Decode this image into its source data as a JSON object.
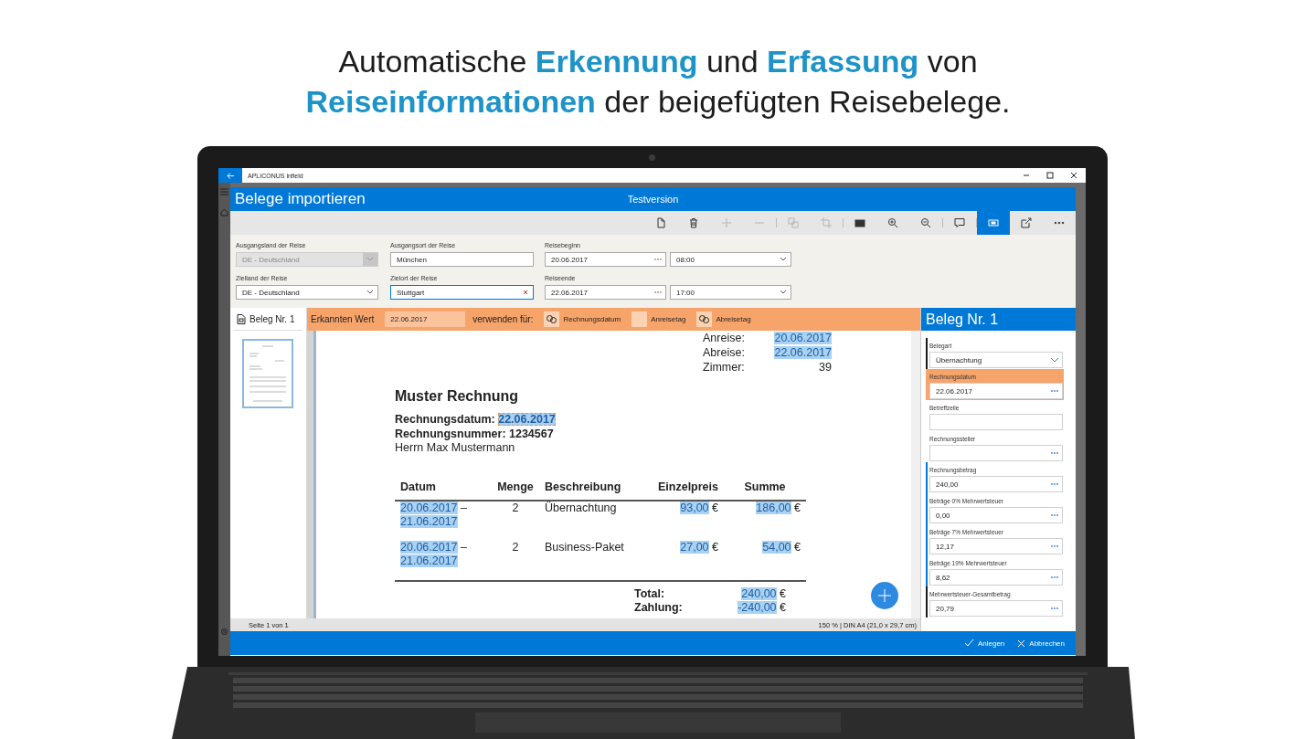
{
  "headline": {
    "lines": [
      "Automatische **Erkennung** und **Erfassung** von",
      "**Reiseinformationen** der beigefügten Reisebelege."
    ]
  },
  "window": {
    "title": "APLICONUS infield"
  },
  "dialog": {
    "title": "Belege importieren",
    "subtitle": "Testversion"
  },
  "toolbar": [
    {
      "kind": "new-document",
      "disabled": false,
      "selected": false
    },
    {
      "kind": "delete",
      "disabled": false,
      "selected": false
    },
    {
      "kind": "add",
      "disabled": true,
      "selected": false
    },
    {
      "kind": "remove",
      "disabled": true,
      "selected": false
    },
    {
      "kind": "separator"
    },
    {
      "kind": "copy",
      "disabled": true,
      "selected": false
    },
    {
      "kind": "crop",
      "disabled": true,
      "selected": false
    },
    {
      "kind": "separator"
    },
    {
      "kind": "fit",
      "disabled": false,
      "selected": false
    },
    {
      "kind": "zoom-in",
      "disabled": false,
      "selected": false
    },
    {
      "kind": "zoom-out",
      "disabled": false,
      "selected": false
    },
    {
      "kind": "separator"
    },
    {
      "kind": "comment",
      "disabled": false,
      "selected": false
    },
    {
      "kind": "separator"
    },
    {
      "kind": "scan",
      "disabled": false,
      "selected": true
    },
    {
      "kind": "export",
      "disabled": false,
      "selected": false
    },
    {
      "kind": "more",
      "disabled": false,
      "selected": false
    }
  ],
  "trip_form": {
    "fields": [
      {
        "kind": "dropdown",
        "label": "Ausgangsland der Reise",
        "value": "DE - Deutschland",
        "disabled": true,
        "focused": false
      },
      {
        "kind": "text",
        "label": "Ausgangsort der Reise",
        "value": "München",
        "disabled": false,
        "focused": false
      },
      {
        "kind": "date",
        "label": "Reisebeginn",
        "value": "20.06.2017",
        "disabled": false,
        "focused": false
      },
      {
        "kind": "dropdown",
        "value": "08:00",
        "disabled": false,
        "focused": false
      },
      {
        "kind": "dropdown",
        "label": "Zielland der Reise",
        "value": "DE - Deutschland",
        "disabled": false,
        "focused": false
      },
      {
        "kind": "text",
        "label": "Zielort der Reise",
        "value": "Stuttgart",
        "disabled": false,
        "focused": true
      },
      {
        "kind": "date",
        "label": "Reiseende",
        "value": "22.06.2017",
        "disabled": false,
        "focused": false
      },
      {
        "kind": "dropdown",
        "value": "17:00",
        "disabled": false,
        "focused": false
      }
    ]
  },
  "documents_pane": {
    "title": "Beleg Nr. 1",
    "thumbnails": [
      {
        "selected": true
      }
    ]
  },
  "recognition_bar": {
    "label": "Erkannten Wert",
    "value": "22.06.2017",
    "use_for": "verwenden für:",
    "targets": [
      {
        "label": "Rechnungsdatum",
        "linked": true
      },
      {
        "label": "Anreisetag",
        "linked": false
      },
      {
        "label": "Abreisetag",
        "linked": true
      }
    ]
  },
  "document": {
    "stay": [
      {
        "label": "Anreise:",
        "value": {
          "text": "20.06.2017",
          "highlighted": true,
          "selected": false
        }
      },
      {
        "label": "Abreise:",
        "value": {
          "text": "22.06.2017",
          "highlighted": true,
          "selected": false
        }
      },
      {
        "label": "Zimmer:",
        "value": {
          "text": "39",
          "highlighted": false
        }
      }
    ],
    "title": "Muster Rechnung",
    "details": [
      {
        "kind": "bold",
        "parts": [
          {
            "text": "Rechnungsdatum:",
            "highlighted": false
          },
          {
            "text": "22.06.2017",
            "highlighted": true,
            "selected": true
          }
        ]
      },
      {
        "kind": "bold",
        "parts": [
          {
            "text": "Rechnungsnummer: 1234567",
            "highlighted": false
          }
        ]
      },
      {
        "kind": "plain",
        "parts": [
          {
            "text": "Herrn Max Mustermann",
            "highlighted": false
          }
        ]
      }
    ],
    "table": {
      "columns": [
        "Datum",
        "Menge",
        "Beschreibung",
        "Einzelpreis",
        "Summe"
      ],
      "rows": [
        [
          [
            {
              "text": "20.06.2017",
              "highlighted": true,
              "selected": false
            },
            {
              "text": "–",
              "highlighted": false
            },
            {
              "text": "21.06.2017",
              "highlighted": true,
              "selected": false
            }
          ],
          [
            {
              "text": "2",
              "highlighted": false
            }
          ],
          [
            {
              "text": "Übernachtung",
              "highlighted": false
            }
          ],
          [
            {
              "text": "93,00",
              "highlighted": true,
              "selected": false
            },
            {
              "text": "€",
              "highlighted": false
            }
          ],
          [
            {
              "text": "186,00",
              "highlighted": true,
              "selected": false
            },
            {
              "text": "€",
              "highlighted": false
            }
          ]
        ],
        [
          [
            {
              "text": "20.06.2017",
              "highlighted": true,
              "selected": false
            },
            {
              "text": "–",
              "highlighted": false
            },
            {
              "text": "21.06.2017",
              "highlighted": true,
              "selected": false
            }
          ],
          [
            {
              "text": "2",
              "highlighted": false
            }
          ],
          [
            {
              "text": "Business-Paket",
              "highlighted": false
            }
          ],
          [
            {
              "text": "27,00",
              "highlighted": true,
              "selected": false
            },
            {
              "text": "€",
              "highlighted": false
            }
          ],
          [
            {
              "text": "54,00",
              "highlighted": true,
              "selected": false
            },
            {
              "text": "€",
              "highlighted": false
            }
          ]
        ]
      ]
    },
    "totals": [
      {
        "label": "Total:",
        "parts": [
          {
            "text": "240,00",
            "highlighted": true,
            "selected": false
          },
          {
            "text": "€",
            "highlighted": false
          }
        ]
      },
      {
        "label": "Zahlung:",
        "parts": [
          {
            "text": "-240,00",
            "highlighted": true,
            "selected": false
          },
          {
            "text": "€",
            "highlighted": false
          }
        ]
      }
    ]
  },
  "status_bar": {
    "page": "Seite 1 von 1",
    "zoom": "150 % | DIN A4 (21,0 x 29,7 cm)"
  },
  "side_panel": {
    "title": "Beleg Nr. 1",
    "fields": [
      {
        "kind": "dropdown",
        "label": "Belegart",
        "value": "Übernachtung",
        "color": "#1a1a1a",
        "highlighted": false
      },
      {
        "kind": "picker",
        "label": "Rechnungsdatum",
        "value": "22.06.2017",
        "highlighted": true
      },
      {
        "kind": "text",
        "label": "Betreffzeile",
        "highlighted": false
      },
      {
        "kind": "picker",
        "label": "Rechnungssteller",
        "highlighted": false
      },
      {
        "kind": "picker",
        "label": "Rechnungsbetrag",
        "value": "240,00",
        "color": "#0078d7",
        "highlighted": false
      },
      {
        "kind": "picker",
        "label": "Beträge 0% Mehrwertsteuer",
        "value": "0,00",
        "color": "#0078d7",
        "highlighted": false
      },
      {
        "kind": "picker",
        "label": "Beträge 7% Mehrwertsteuer",
        "value": "12,17",
        "color": "#0078d7",
        "highlighted": false
      },
      {
        "kind": "picker",
        "label": "Beträge 19% Mehrwertsteuer",
        "value": "8,62",
        "color": "#0078d7",
        "highlighted": false
      },
      {
        "kind": "picker",
        "label": "Mehrwertsteuer-Gesamtbetrag",
        "value": "20,79",
        "color": "#1a1a1a",
        "highlighted": false
      }
    ]
  },
  "actions": [
    {
      "kind": "confirm",
      "label": "Anlegen"
    },
    {
      "kind": "cancel",
      "label": "Abbrechen"
    }
  ]
}
